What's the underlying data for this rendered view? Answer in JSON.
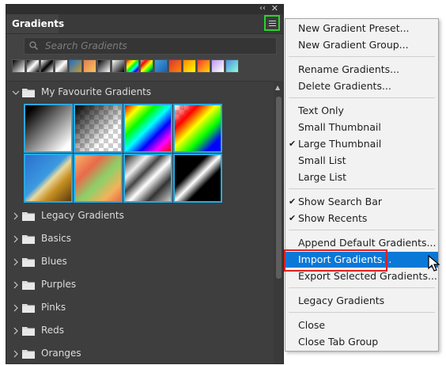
{
  "panel": {
    "tab_label": "Gradients",
    "search_placeholder": "Search Gradients",
    "collapse_glyph": "‹‹",
    "close_glyph": "✕",
    "recent_swatches": [
      "linear-gradient(135deg,#000,#fff)",
      "linear-gradient(135deg,#000,#fff 50%,#000)",
      "linear-gradient(135deg,#fff,#000,#fff)",
      "linear-gradient(135deg,#555,#fff,#555)",
      "linear-gradient(135deg,#1a6fd0,#c79a2b)",
      "linear-gradient(135deg,#e77b52,#f3c75f)",
      "linear-gradient(135deg,#000,#fff)",
      "linear-gradient(135deg,#fff,#000)",
      "linear-gradient(135deg,red,orange,yellow,lime,cyan,blue,magenta)",
      "linear-gradient(135deg,#bbb,red,yellow,lime,blue)",
      "linear-gradient(135deg,#3fa0e0,#1a5fb0)",
      "linear-gradient(135deg,#d33,#f80)",
      "linear-gradient(135deg,#f80,#ff0)",
      "linear-gradient(135deg,#f33,#fd0)",
      "linear-gradient(135deg,#b9e,#fff)",
      "linear-gradient(135deg,#4f8fe0,#8fd)"
    ],
    "favourites": {
      "label": "My Favourite Gradients",
      "thumbs": [
        "linear-gradient(135deg,#000 10%,#fff 90%)",
        "linear-gradient(135deg,#000 0%,rgba(0,0,0,0) 70%),repeating-conic-gradient(#ccc 0% 25%,#fff 0% 50%) 0 0/12px 12px",
        "linear-gradient(135deg,#f00,#ff0,#0f0,#0ff,#00f,#f0f,#f00)",
        "linear-gradient(135deg,rgba(255,0,0,0) 0%,rgba(255,0,0,1) 25%,#ff0 45%,#0f0 65%,#00f 85%),repeating-conic-gradient(#ccc 0% 25%,#fff 0% 50%) 0 0/12px 12px",
        "linear-gradient(135deg,#2a6fd0 0%,#3b9ae0 45%,#e8d9a0 55%,#c79022 70%,#5a3a10 100%)",
        "linear-gradient(135deg,#f7b46a 0%,#e86b4a 30%,#8bd06a 55%,#f2b35a 80%,#e86a4a 100%)",
        "linear-gradient(135deg,#222 0%,#eee 25%,#444 40%,#fff 55%,#333 75%,#ccc 100%)",
        "linear-gradient(135deg,#000 0%,#000 35%,#fff 50%,#000 65%,#000 100%)"
      ]
    },
    "groups": [
      {
        "label": "Legacy Gradients"
      },
      {
        "label": "Basics"
      },
      {
        "label": "Blues"
      },
      {
        "label": "Purples"
      },
      {
        "label": "Pinks"
      },
      {
        "label": "Reds"
      },
      {
        "label": "Oranges"
      }
    ]
  },
  "menu": {
    "items": [
      {
        "label": "New Gradient Preset...",
        "checked": false
      },
      {
        "label": "New Gradient Group...",
        "checked": false
      },
      {
        "label": "Rename Gradients...",
        "checked": false
      },
      {
        "label": "Delete Gradients...",
        "checked": false
      },
      {
        "label": "Text Only",
        "checked": false
      },
      {
        "label": "Small Thumbnail",
        "checked": false
      },
      {
        "label": "Large Thumbnail",
        "checked": true
      },
      {
        "label": "Small List",
        "checked": false
      },
      {
        "label": "Large List",
        "checked": false
      },
      {
        "label": "Show Search Bar",
        "checked": true
      },
      {
        "label": "Show Recents",
        "checked": true
      },
      {
        "label": "Append Default Gradients...",
        "checked": false
      },
      {
        "label": "Import Gradients...",
        "checked": false,
        "highlighted": true
      },
      {
        "label": "Export Selected Gradients...",
        "checked": false
      },
      {
        "label": "Legacy Gradients",
        "checked": false
      },
      {
        "label": "Close",
        "checked": false
      },
      {
        "label": "Close Tab Group",
        "checked": false
      }
    ],
    "check_glyph": "✔"
  },
  "colors": {
    "accent_highlight": "#0a78d7",
    "annotation_red": "#e02020",
    "annotation_green": "#2dd12d",
    "thumb_border": "#2aa8e0"
  }
}
